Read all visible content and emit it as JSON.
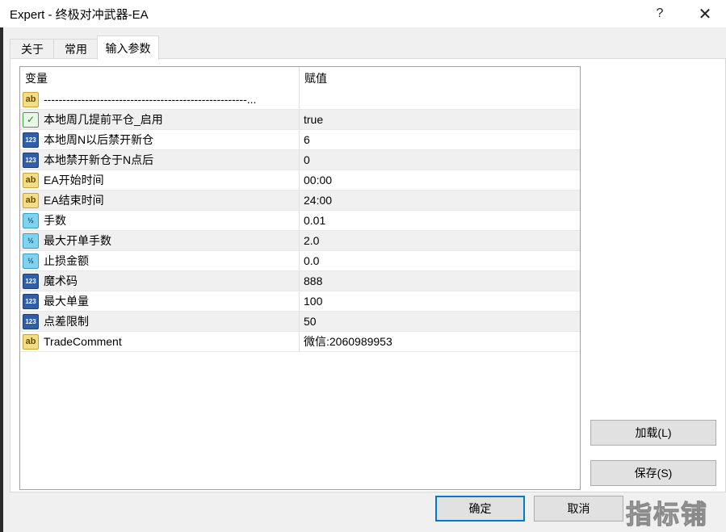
{
  "window": {
    "title": "Expert - 终极对冲武器-EA",
    "help_label": "?",
    "close_label": "✕"
  },
  "tabs": [
    {
      "label": "关于",
      "active": false
    },
    {
      "label": "常用",
      "active": false
    },
    {
      "label": "输入参数",
      "active": true
    }
  ],
  "grid": {
    "headers": {
      "variable": "变量",
      "value": "赋值"
    },
    "rows": [
      {
        "icon": "ab",
        "name": "------------------------------------------------------...",
        "value": ""
      },
      {
        "icon": "bool",
        "name": "本地周几提前平仓_启用",
        "value": "true"
      },
      {
        "icon": "123",
        "name": "本地周N以后禁开新仓",
        "value": "6"
      },
      {
        "icon": "123",
        "name": "本地禁开新仓于N点后",
        "value": "0"
      },
      {
        "icon": "ab",
        "name": "EA开始时间",
        "value": "00:00"
      },
      {
        "icon": "ab",
        "name": "EA结束时间",
        "value": "24:00"
      },
      {
        "icon": "half",
        "name": "手数",
        "value": "0.01"
      },
      {
        "icon": "half",
        "name": "最大开单手数",
        "value": "2.0"
      },
      {
        "icon": "half",
        "name": "止损金额",
        "value": "0.0"
      },
      {
        "icon": "123",
        "name": "魔术码",
        "value": "888"
      },
      {
        "icon": "123",
        "name": "最大单量",
        "value": "100"
      },
      {
        "icon": "123",
        "name": "点差限制",
        "value": "50"
      },
      {
        "icon": "ab",
        "name": "TradeComment",
        "value": "微信:2060989953"
      }
    ]
  },
  "icon_glyphs": {
    "ab": "ab",
    "123": "123",
    "half": "½",
    "bool": "✓"
  },
  "buttons": {
    "load": "加载(L)",
    "save": "保存(S)",
    "ok": "确定",
    "cancel": "取消"
  },
  "watermark": "指标铺"
}
